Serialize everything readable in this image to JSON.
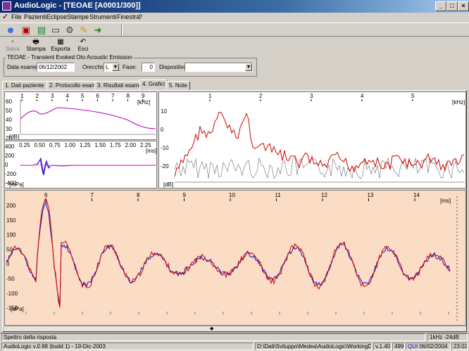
{
  "window": {
    "title": "AudioLogic - [TEOAE [A0001/300]]"
  },
  "menu": [
    "File",
    "Pazienti",
    "Eclipse",
    "Stampe",
    "Strumenti",
    "Finestra",
    "?"
  ],
  "toolbar_icons": [
    "patients-icon",
    "print-setup-icon",
    "network-icon",
    "folder-icon",
    "settings-icon",
    "wizard-icon",
    "exit-door-icon"
  ],
  "actions": [
    {
      "label": "Salva",
      "icon": "save-icon",
      "enabled": false
    },
    {
      "label": "Stampa",
      "icon": "printer-icon",
      "enabled": true
    },
    {
      "label": "Esporta",
      "icon": "export-icon",
      "enabled": true
    },
    {
      "label": "Esci",
      "icon": "undo-icon",
      "enabled": true
    }
  ],
  "exam": {
    "group_title": "TEOAE - Transient Evoked Oto Acoustic Emission",
    "date_label": "Data esame:",
    "date_value": "06/12/2002",
    "ear_label": "Orecchio:",
    "ear_value": "L",
    "phase_label": "Fase:",
    "phase_value": "0",
    "device_label": "Dispositivo:",
    "device_value": ""
  },
  "tabs": [
    {
      "label": "1. Dati paziente",
      "active": false
    },
    {
      "label": "2. Protocollo esame",
      "active": false
    },
    {
      "label": "3. Risultati esame",
      "active": false
    },
    {
      "label": "4. Grafici",
      "active": true
    },
    {
      "label": "5. Note",
      "active": false
    }
  ],
  "charts": {
    "tl": {
      "top_ticks": [
        "1",
        "2",
        "3",
        "4",
        "5",
        "6",
        "7",
        "8",
        "9"
      ],
      "unit_x": "[kHz]",
      "unit_y": "[dB]",
      "y_ticks": [
        "60",
        "50",
        "40",
        "30",
        "20"
      ]
    },
    "ml": {
      "x_ticks": [
        "0.25",
        "0.50",
        "0.75",
        "1.00",
        "1.25",
        "1.50",
        "1.75",
        "2.00",
        "2.25"
      ],
      "unit_x": "[ms]",
      "unit_y": "[mPa]",
      "y_ticks": [
        "400",
        "200",
        "0",
        "-200",
        "-400"
      ]
    },
    "tr": {
      "top_ticks": [
        "1",
        "2",
        "3",
        "4",
        "5"
      ],
      "unit_x": "[kHz]",
      "unit_y": "[dB]",
      "y_ticks": [
        "10",
        "0",
        "-10",
        "-20"
      ]
    },
    "bottom": {
      "top_ticks": [
        "6",
        "7",
        "8",
        "9",
        "10",
        "11",
        "12",
        "13",
        "14"
      ],
      "unit_x": "[ms]",
      "unit_y": "[uPa]",
      "y_ticks": [
        "200",
        "150",
        "100",
        "50",
        "0",
        "-50",
        "-100",
        "-150"
      ]
    }
  },
  "status": {
    "left": "Spettro della risposta",
    "right": "1kHz -24dB"
  },
  "bottom": {
    "version": "AudioLogic v.0.98 (build 1) - 19-Dic-2003",
    "path": "D:\\Dati\\Sviluppo\\Medea\\AudioLogic\\WorkingDb.mdb",
    "ver": "v.1.40",
    "num": "499",
    "date": "06/02/2004",
    "time": "23:02"
  },
  "colors": {
    "response_red": "#d40000",
    "response_blue": "#0018c8",
    "envelope_magenta": "#c000c0",
    "noise_gray": "#808080",
    "plot_bg": "#fbdcc4"
  }
}
